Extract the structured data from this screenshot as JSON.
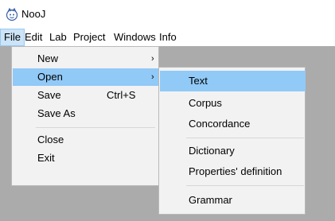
{
  "window": {
    "title": "NooJ",
    "icon": "nooj-app-icon"
  },
  "menubar": {
    "items": [
      {
        "label": "File",
        "active": true
      },
      {
        "label": "Edit"
      },
      {
        "label": "Lab"
      },
      {
        "label": "Project"
      },
      {
        "label": "Windows"
      },
      {
        "label": "Info"
      }
    ]
  },
  "file_menu": {
    "items": [
      {
        "label": "New",
        "submenu": true,
        "icon": "chevron-right-icon"
      },
      {
        "label": "Open",
        "submenu": true,
        "highlighted": true,
        "icon": "chevron-right-icon"
      },
      {
        "label": "Save",
        "shortcut": "Ctrl+S"
      },
      {
        "label": "Save As"
      },
      {
        "label": "Close"
      },
      {
        "label": "Exit"
      }
    ]
  },
  "open_submenu": {
    "items": [
      {
        "label": "Text",
        "highlighted": true
      },
      {
        "label": "Corpus"
      },
      {
        "label": "Concordance"
      },
      {
        "label": "Dictionary"
      },
      {
        "label": "Properties' definition"
      },
      {
        "label": "Grammar"
      }
    ]
  },
  "colors": {
    "workspace": "#ababab",
    "menu_bg": "#f2f2f2",
    "highlight": "#91c9f7",
    "menubar_active": "#cce4f7"
  }
}
